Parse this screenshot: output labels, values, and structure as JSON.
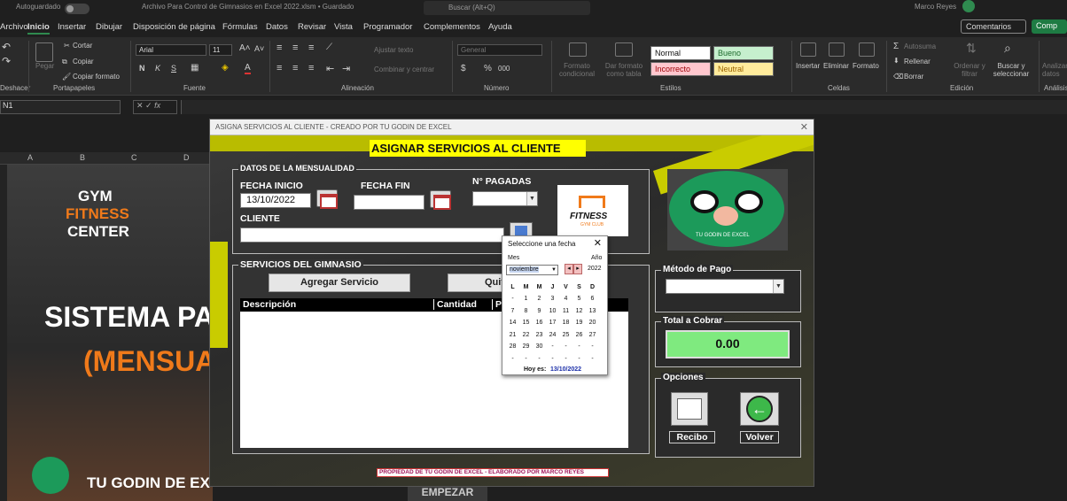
{
  "titlebar": {
    "autosave": "Autoguardado",
    "filename": "Archivo Para Control de Gimnasios en Excel 2022.xlsm • Guardado",
    "search": "Buscar (Alt+Q)",
    "user": "Marco Reyes"
  },
  "menu": {
    "tabs": [
      "Archivo",
      "Inicio",
      "Insertar",
      "Dibujar",
      "Disposición de página",
      "Fórmulas",
      "Datos",
      "Revisar",
      "Vista",
      "Programador",
      "Complementos",
      "Ayuda"
    ],
    "comments": "Comentarios",
    "share": "Comp"
  },
  "ribbon": {
    "cut": "Cortar",
    "copy": "Copiar",
    "paste": "Pegar",
    "format_painter": "Copiar formato",
    "font_name": "Arial",
    "font_size": "11",
    "bold": "N",
    "italic": "K",
    "underline": "S",
    "wrap": "Ajustar texto",
    "merge": "Combinar y centrar",
    "number_format": "General",
    "currency": "$",
    "percent": "%",
    "thousands": "000",
    "cond_format": "Formato condicional",
    "format_table": "Dar formato como tabla",
    "styles": {
      "normal": "Normal",
      "bueno": "Bueno",
      "incorrecto": "Incorrecto",
      "neutral": "Neutral"
    },
    "insert": "Insertar",
    "delete": "Eliminar",
    "format": "Formato",
    "autosum": "Autosuma",
    "fill": "Rellenar",
    "clear": "Borrar",
    "sort": "Ordenar y filtrar",
    "find": "Buscar y seleccionar",
    "analyze": "Analizar datos",
    "groups": {
      "undo": "Deshacer",
      "clipboard": "Portapapeles",
      "font": "Fuente",
      "alignment": "Alineación",
      "number": "Número",
      "styles": "Estilos",
      "cells": "Celdas",
      "editing": "Edición",
      "analysis": "Análisis"
    }
  },
  "formula_bar": {
    "namebox": "N1",
    "fx": "fx"
  },
  "sheet": {
    "columns": [
      "A",
      "B",
      "C",
      "D"
    ],
    "poster": {
      "gym": "GYM",
      "fitness": "FITNESS",
      "center": "CENTER",
      "sistema": "SISTEMA PA",
      "mensual": "(MENSUA",
      "brand": "TU GODIN DE EXCEL"
    },
    "start_button": "EMPEZAR"
  },
  "form": {
    "title": "ASIGNA SERVICIOS AL CLIENTE - CREADO POR TU GODIN DE EXCEL",
    "heading": "ASIGNAR SERVICIOS AL CLIENTE",
    "mensualidad_frame": "DATOS DE LA MENSUALIDAD",
    "fecha_inicio_label": "FECHA INICIO",
    "fecha_inicio_value": "13/10/2022",
    "fecha_fin_label": "FECHA FIN",
    "pagadas_label": "N° PAGADAS",
    "cliente_label": "CLIENTE",
    "logo_text": "FITNESS",
    "logo_sub": "GYM CLUB",
    "avatar_caption": "TU GODIN DE EXCEL",
    "servicios_frame": "SERVICIOS DEL GIMNASIO",
    "add_service": "Agregar Servicio",
    "remove_service": "Quit",
    "grid_headers": [
      "Descripción",
      "Cantidad",
      "P"
    ],
    "payment_frame": "Método de Pago",
    "total_frame": "Total a Cobrar",
    "total_value": "0.00",
    "options_frame": "Opciones",
    "receipt": "Recibo",
    "back": "Volver",
    "footer": "PROPIEDAD DE TU GODIN DE EXCEL - ELABORADO POR MARCO REYES"
  },
  "calendar": {
    "title": "Seleccione una fecha",
    "month_label": "Mes",
    "year_label": "Año",
    "month": "noviembre",
    "year": "2022",
    "dow": [
      "L",
      "M",
      "M",
      "J",
      "V",
      "S",
      "D"
    ],
    "weeks": [
      [
        "-",
        "1",
        "2",
        "3",
        "4",
        "5",
        "6"
      ],
      [
        "7",
        "8",
        "9",
        "10",
        "11",
        "12",
        "13"
      ],
      [
        "14",
        "15",
        "16",
        "17",
        "18",
        "19",
        "20"
      ],
      [
        "21",
        "22",
        "23",
        "24",
        "25",
        "26",
        "27"
      ],
      [
        "28",
        "29",
        "30",
        "-",
        "-",
        "-",
        "-"
      ],
      [
        "-",
        "-",
        "-",
        "-",
        "-",
        "-",
        "-"
      ]
    ],
    "today_label": "Hoy es:",
    "today": "13/10/2022"
  },
  "colors": {
    "accent_yellow": "#ffff00",
    "green": "#7fea7f",
    "excel_green": "#2f8a4f"
  }
}
